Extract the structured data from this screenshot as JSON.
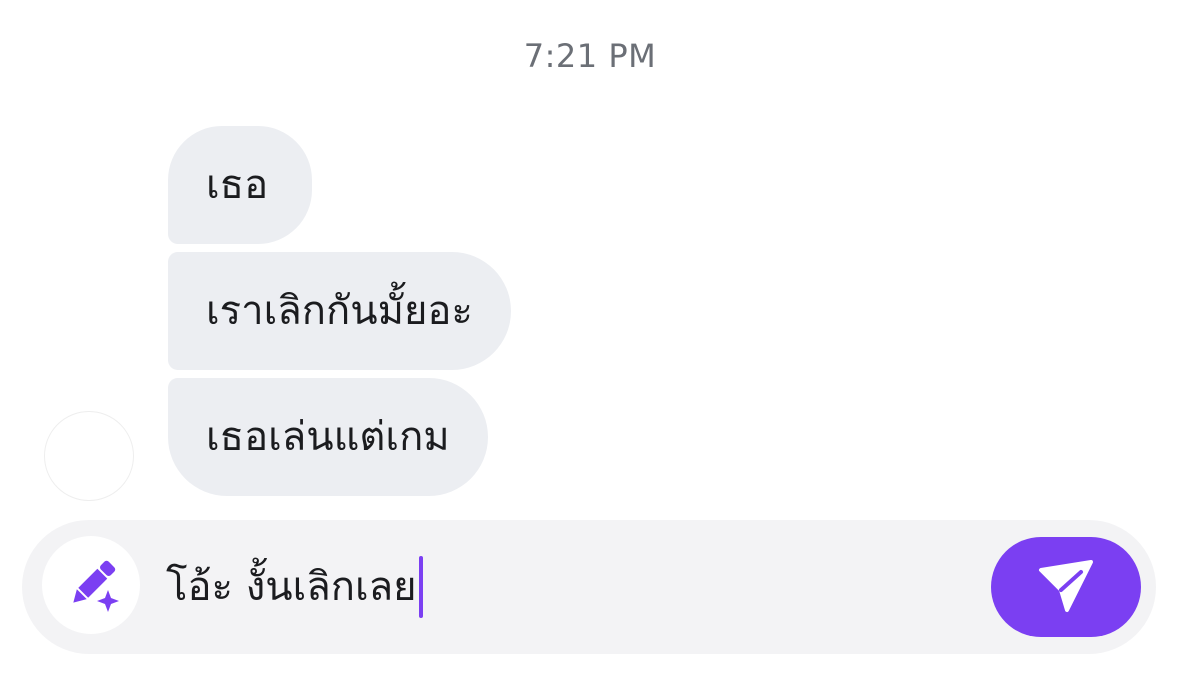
{
  "chat": {
    "timestamp": "7:21 PM",
    "messages": [
      {
        "text": "เธอ"
      },
      {
        "text": "เราเลิกกันมั้ยอะ"
      },
      {
        "text": "เธอเล่นแต่เกม"
      }
    ]
  },
  "composer": {
    "input_value": "โอ้ะ งั้นเลิกเลย",
    "pen_icon": "magic-pen-icon",
    "send_icon": "paper-plane-icon"
  },
  "colors": {
    "accent": "#7b3ff2",
    "bubble_bg": "#eceef2",
    "composer_bg": "#f3f3f5",
    "timestamp": "#6b6f76"
  }
}
